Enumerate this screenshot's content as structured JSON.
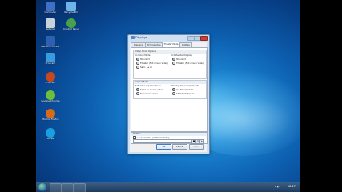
{
  "desktop_icons": [
    {
      "label": "Computer",
      "icon": "computer-icon",
      "color": "#3f70c8"
    },
    {
      "label": "Recycle Bin",
      "icon": "recycle-bin-icon",
      "color": "#6fb4e8"
    },
    {
      "label": "Network",
      "icon": "network-icon",
      "color": "#c8d2dc"
    },
    {
      "label": "Control Panel",
      "icon": "control-panel-icon",
      "color": "#4aa04a"
    },
    {
      "label": "Network Center",
      "icon": "network-center-icon",
      "color": "#2f5fb0"
    },
    {
      "label": "Program",
      "icon": "program-icon",
      "color": "#3a9be0"
    },
    {
      "label": "Program",
      "icon": "program-icon",
      "color": "#c8481e"
    },
    {
      "label": "Google Chrome",
      "icon": "chrome-icon",
      "color": "#6bbf3a"
    },
    {
      "label": "Mozilla Firefox",
      "icon": "firefox-icon",
      "color": "#d86a1a"
    },
    {
      "label": "Skype",
      "icon": "skype-icon",
      "color": "#1aa0e0"
    }
  ],
  "window": {
    "title": "Displays",
    "tabs": [
      "Displays",
      "TV Properties",
      "Theater Mode",
      "Profiles"
    ],
    "active_tab": 2,
    "theater_section": "Video Mode Options",
    "clone_mode_label": "In Clone Mode",
    "extended_label": "In Extended Display",
    "clone_options": [
      "Standard",
      "Theater (Full screen Video)",
      "Same as all"
    ],
    "extended_options": [
      "Standard",
      "Theater (Full screen Video)"
    ],
    "aspect_section": "Aspect Ratio",
    "aspect_left_label": "Set video aspect ratio to",
    "aspect_right_label": "Display device aspect ratio",
    "aspect_left_options": [
      "Same as source video",
      "Full screen video"
    ],
    "aspect_right_options": [
      "4:3 Standard TV",
      "16:9 Wide Screen"
    ],
    "profiles_section": "Profiles",
    "profiles_checkbox": "Load selected profile at startup",
    "ok": "Ok",
    "cancel": "Cancel",
    "apply": "Apply"
  },
  "taskbar": {
    "time": "18:27"
  }
}
